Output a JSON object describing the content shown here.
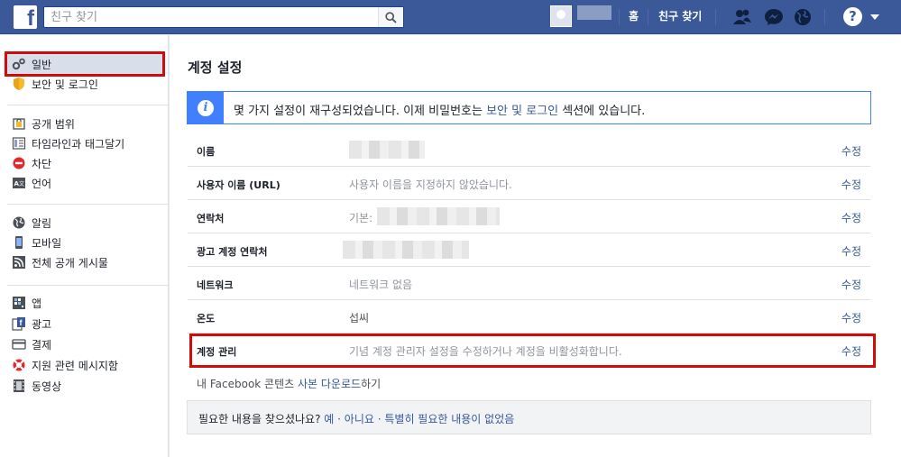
{
  "topbar": {
    "logo": "f",
    "search_placeholder": "친구 찾기",
    "home_label": "홈",
    "find_friends_label": "친구 찾기",
    "help_glyph": "?",
    "icons": [
      "friend-requests-icon",
      "messenger-icon",
      "notifications-globe-icon",
      "help-icon",
      "caret-down-icon"
    ]
  },
  "sidebar": {
    "groups": [
      [
        {
          "label": "일반",
          "icon": "gears-icon",
          "active": true
        },
        {
          "label": "보안 및 로그인",
          "icon": "shield-icon",
          "active": false
        }
      ],
      [
        {
          "label": "공개 범위",
          "icon": "lock-icon",
          "active": false
        },
        {
          "label": "타임라인과 태그달기",
          "icon": "timeline-icon",
          "active": false
        },
        {
          "label": "차단",
          "icon": "block-icon",
          "active": false
        },
        {
          "label": "언어",
          "icon": "language-icon",
          "active": false
        }
      ],
      [
        {
          "label": "알림",
          "icon": "globe-icon",
          "active": false
        },
        {
          "label": "모바일",
          "icon": "mobile-icon",
          "active": false
        },
        {
          "label": "전체 공개 게시물",
          "icon": "rss-icon",
          "active": false
        }
      ],
      [
        {
          "label": "앱",
          "icon": "apps-icon",
          "active": false
        },
        {
          "label": "광고",
          "icon": "ads-icon",
          "active": false
        },
        {
          "label": "결제",
          "icon": "card-icon",
          "active": false
        },
        {
          "label": "지원 관련 메시지함",
          "icon": "lifebuoy-icon",
          "active": false
        },
        {
          "label": "동영상",
          "icon": "film-icon",
          "active": false
        }
      ]
    ]
  },
  "main": {
    "title": "계정 설정",
    "notice": {
      "prefix": "몇 가지 설정이 재구성되었습니다. 이제 비밀번호는 ",
      "link": "보안 및 로그인",
      "suffix": " 섹션에 있습니다."
    },
    "edit_label": "수정",
    "rows": [
      {
        "label": "이름",
        "value": "",
        "blurred": true
      },
      {
        "label": "사용자 이름 (URL)",
        "value": "사용자 이름을 지정하지 않았습니다."
      },
      {
        "label": "연락처",
        "value": "기본:",
        "blurred": true
      },
      {
        "label": "광고 계정 연락처",
        "value": "",
        "blurred": true
      },
      {
        "label": "네트워크",
        "value": "네트워크 없음"
      },
      {
        "label": "온도",
        "value": "섭씨"
      },
      {
        "label": "계정 관리",
        "value": "기념 계정 관리자 설정을 수정하거나 계정을 비활성화합니다."
      }
    ],
    "download": {
      "prefix": "내 Facebook 콘텐츠 ",
      "link": "사본 다운로드",
      "suffix": "하기"
    },
    "feedback": {
      "question": "필요한 내용을 찾으셨나요?",
      "yes": "예",
      "no": "아니요",
      "other": "특별히 필요한 내용이 없었음",
      "sep": " · "
    }
  }
}
